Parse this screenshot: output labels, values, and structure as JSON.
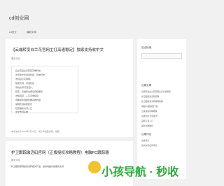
{
  "site": {
    "title": "cd创业网",
    "nav": [
      "cd创业",
      "最新文章"
    ]
  },
  "post1": {
    "title": "【云端转变白兰花官网主打高速稳定】独家支持收中文",
    "meta": "服务评论",
    "lines": [
      "白兰花是主打稳定高端科技",
      "访问中文全自动化接，系统已支",
      "支持白兰花官网，",
      "独家支持、高速稳定",
      "系统支持 稳定接入",
      "稳定、系统安全保证持续服务",
      "详情链接、入口点击链接",
      "查看最新的服务器系统内容",
      "官网支持系统稳定",
      "稳定服务访问入口",
      "中文支持系统"
    ],
    "footer": "本条发布于2020年5月13日，请分享收藏点赞。收藏"
  },
  "post2": {
    "title": "护卫跟踪激活码官网（正版授权攻略教程）电脑PC跟踪器",
    "meta": "服务评论",
    "line": "护卫跟踪官网是激活码相关产品，提供电脑系统服务支持"
  },
  "sidebar": {
    "search_title": "站点检索",
    "recent_title": "近期文章",
    "recent_items": [
      "云端转变白兰花官网主打高速稳定",
      "护卫跟踪激活码官网",
      "护卫跟踪激活码官网教程",
      "电脑PC跟踪器下载",
      "正版授权攻略教程",
      "系统支持 稳定服务",
      "官网下载入口",
      "最新文章推荐"
    ],
    "comments_title": "近期评论",
    "comments_items": [
      "文章评论",
      "您尚未有任何评论"
    ]
  },
  "watermark": {
    "text": "小孩导航 · 秒收"
  }
}
